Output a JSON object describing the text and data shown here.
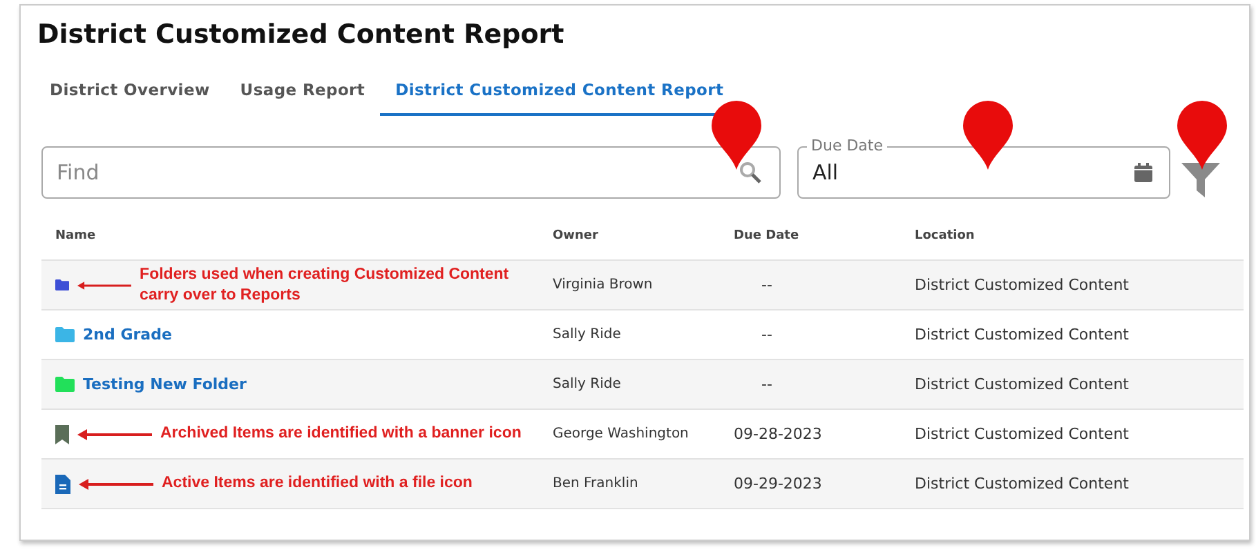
{
  "title": "District Customized Content Report",
  "tabs": [
    {
      "label": "District Overview",
      "selected": false
    },
    {
      "label": "Usage Report",
      "selected": false
    },
    {
      "label": "District Customized Content Report",
      "selected": true
    }
  ],
  "search": {
    "placeholder": "Find"
  },
  "due_date": {
    "label": "Due Date",
    "value": "All"
  },
  "table": {
    "columns": [
      "Name",
      "Owner",
      "Due Date",
      "Location"
    ],
    "rows": [
      {
        "kind": "folder",
        "color": "#3d4fd6",
        "note": "Folders used when creating Customized Content carry over to Reports",
        "owner": "Virginia Brown",
        "due_date": "--",
        "location": "District Customized Content"
      },
      {
        "kind": "folder",
        "color": "#3bb5e6",
        "name": "2nd Grade",
        "owner": "Sally Ride",
        "due_date": "--",
        "location": "District Customized Content"
      },
      {
        "kind": "folder",
        "color": "#22e05a",
        "name": "Testing New Folder",
        "owner": "Sally Ride",
        "due_date": "--",
        "location": "District Customized Content"
      },
      {
        "kind": "archived",
        "note": "Archived Items are identified with a banner icon",
        "owner": "George Washington",
        "due_date": "09-28-2023",
        "location": "District Customized Content"
      },
      {
        "kind": "file",
        "note": "Active Items are identified with a file icon",
        "owner": "Ben Franklin",
        "due_date": "09-29-2023",
        "location": "District Customized Content"
      }
    ]
  }
}
